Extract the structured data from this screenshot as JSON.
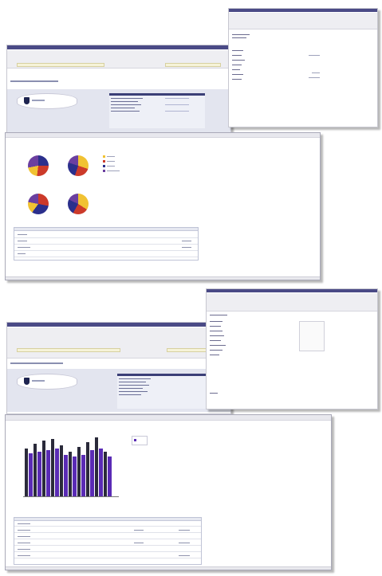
{
  "colors": {
    "titlebar": "#4a4a86",
    "bar_purple": "#5a2bb5",
    "pie_colors": [
      "#f1c232",
      "#cc3a2a",
      "#2b2f8c",
      "#6b3fa0"
    ]
  },
  "figure": {
    "top_group": {
      "main_window": {
        "title": "",
        "address": "",
        "tabs": []
      },
      "side_window": {
        "title": "",
        "list_items": []
      },
      "report_panel": {
        "pie_count": 4,
        "legend_items": 4
      }
    },
    "bottom_group": {
      "main_window": {
        "title": "",
        "address": "",
        "tabs": []
      },
      "side_window": {
        "title": "",
        "list_items": []
      },
      "report_panel": {
        "bar_count": 20
      }
    }
  }
}
